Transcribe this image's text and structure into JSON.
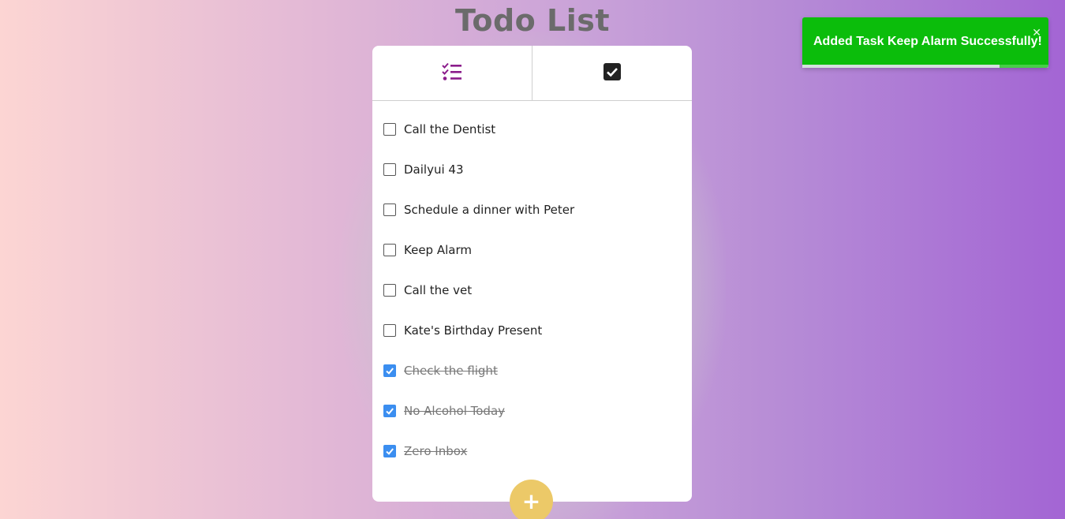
{
  "page": {
    "title": "Todo List"
  },
  "tabs": [
    {
      "name": "tasks-tab",
      "icon": "checklist-icon",
      "color": "#8b1d8b"
    },
    {
      "name": "completed-tab",
      "icon": "checked-box-icon",
      "color": "#222222"
    }
  ],
  "tasks": [
    {
      "label": "Call the Dentist",
      "done": false
    },
    {
      "label": "Dailyui 43",
      "done": false
    },
    {
      "label": "Schedule a dinner with Peter",
      "done": false
    },
    {
      "label": "Keep Alarm",
      "done": false
    },
    {
      "label": "Call the vet",
      "done": false
    },
    {
      "label": "Kate's Birthday Present",
      "done": false
    },
    {
      "label": "Check the flight",
      "done": true
    },
    {
      "label": "No Alcohol Today",
      "done": true
    },
    {
      "label": "Zero Inbox",
      "done": true
    }
  ],
  "add_button": {
    "label": "+",
    "color": "#ecc968"
  },
  "toast": {
    "message": "Added Task Keep Alarm Successfully!",
    "close_label": "✕",
    "progress": 0.8,
    "color": "#0bbd0b"
  }
}
